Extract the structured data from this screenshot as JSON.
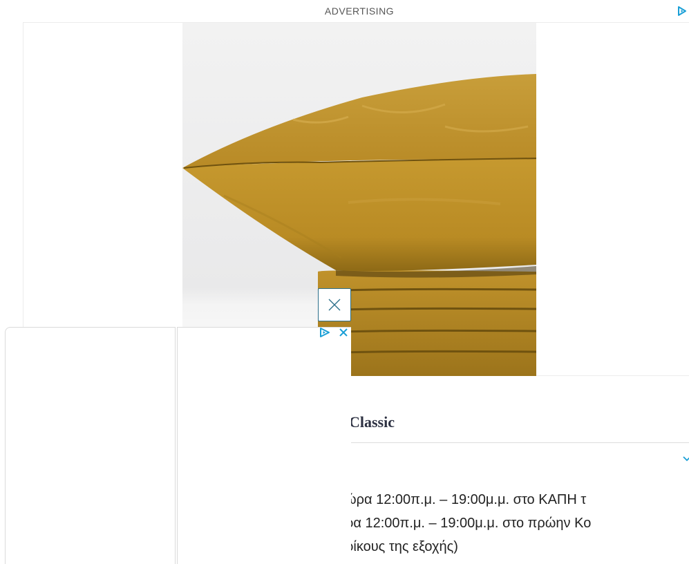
{
  "ad": {
    "label": "ADVERTISING"
  },
  "article": {
    "heading_fragment": "Classic",
    "line1": "ώρα 12:00π.μ. – 19:00μ.μ. στο ΚΑΠΗ τ",
    "line2": "ρα 12:00π.μ. – 19:00μ.μ. στο πρώην Κο",
    "line3": "ρίκους της εξοχής)"
  },
  "colors": {
    "accent": "#1a9fd6",
    "close_border": "#2b6f8a",
    "pillow": "#c4982f",
    "heading": "#2d3142"
  },
  "icons": {
    "adchoices": "adchoices-play-icon",
    "close": "close-icon",
    "chevron": "chevron-down-icon"
  }
}
